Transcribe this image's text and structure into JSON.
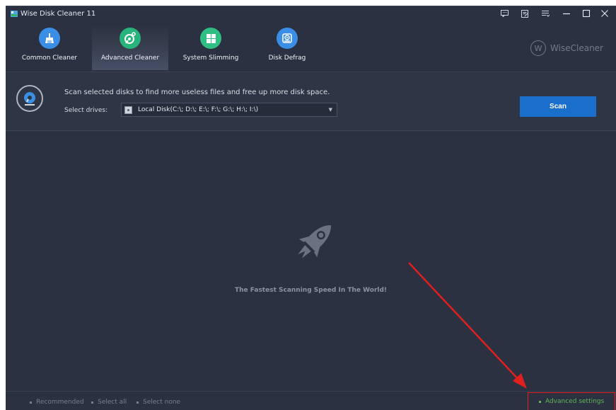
{
  "window": {
    "title": "Wise Disk Cleaner 11",
    "controls": [
      "feedback-icon",
      "notes-icon",
      "menu-icon",
      "minimize-icon",
      "maximize-icon",
      "close-icon"
    ]
  },
  "toolbar": {
    "tools": [
      {
        "label": "Common Cleaner",
        "icon": "broom-icon",
        "color": "#3a8ee6"
      },
      {
        "label": "Advanced Cleaner",
        "icon": "disk-scan-icon",
        "color": "#27b37a"
      },
      {
        "label": "System Slimming",
        "icon": "windows-icon",
        "color": "#2fbf84"
      },
      {
        "label": "Disk Defrag",
        "icon": "defrag-icon",
        "color": "#3a8ee6"
      }
    ],
    "active": "Advanced Cleaner",
    "brand": "WiseCleaner",
    "brand_logo": "W"
  },
  "scan": {
    "description": "Scan selected disks to find more useless files and free up more disk space.",
    "drives_label": "Select drives:",
    "drives_value": "Local Disk(C:\\; D:\\; E:\\; F:\\; G:\\; H:\\; I:\\)",
    "scan_label": "Scan"
  },
  "main": {
    "tagline": "The Fastest Scanning Speed In The World!"
  },
  "bottom": {
    "recommended": "Recommended",
    "select_all": "Select all",
    "select_none": "Select none",
    "advanced_settings": "Advanced settings"
  },
  "colors": {
    "background": "#2b3140",
    "accent": "#1a6fcc",
    "highlight_border": "#e01f1f",
    "annotation_arrow": "#e01f1f",
    "advanced_settings_text": "#5fb85a"
  }
}
